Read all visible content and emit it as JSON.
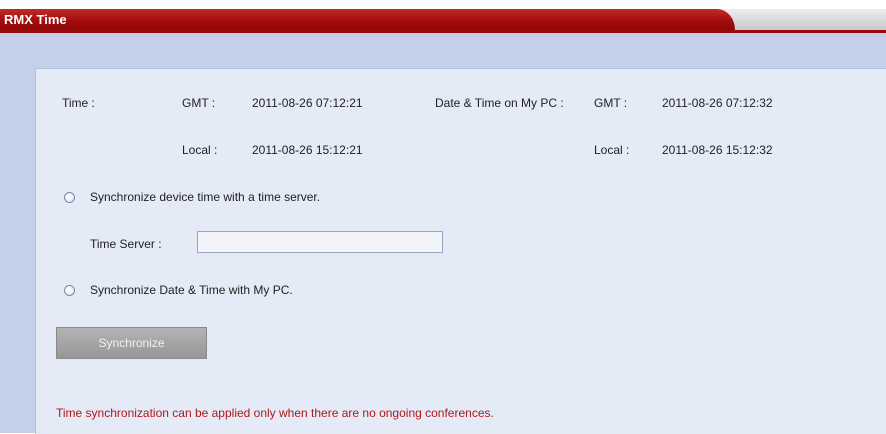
{
  "window": {
    "title": "RMX Time"
  },
  "time": {
    "label": "Time :",
    "gmt_label": "GMT :",
    "gmt_value": "2011-08-26 07:12:21",
    "local_label": "Local :",
    "local_value": "2011-08-26 15:12:21"
  },
  "pc_time": {
    "label": "Date & Time on My PC :",
    "gmt_label": "GMT :",
    "gmt_value": "2011-08-26 07:12:32",
    "local_label": "Local :",
    "local_value": "2011-08-26 15:12:32"
  },
  "options": {
    "sync_server_label": "Synchronize device time with a time server.",
    "time_server_label": "Time Server :",
    "time_server_value": "",
    "sync_pc_label": "Synchronize Date & Time with My PC."
  },
  "actions": {
    "synchronize_label": "Synchronize"
  },
  "note": "Time synchronization can be applied only when there are no ongoing conferences.",
  "colors": {
    "title_bar": "#a50c0c",
    "background": "#c4cfe9",
    "panel": "#e5eaf7",
    "note_text": "#b0181b"
  }
}
